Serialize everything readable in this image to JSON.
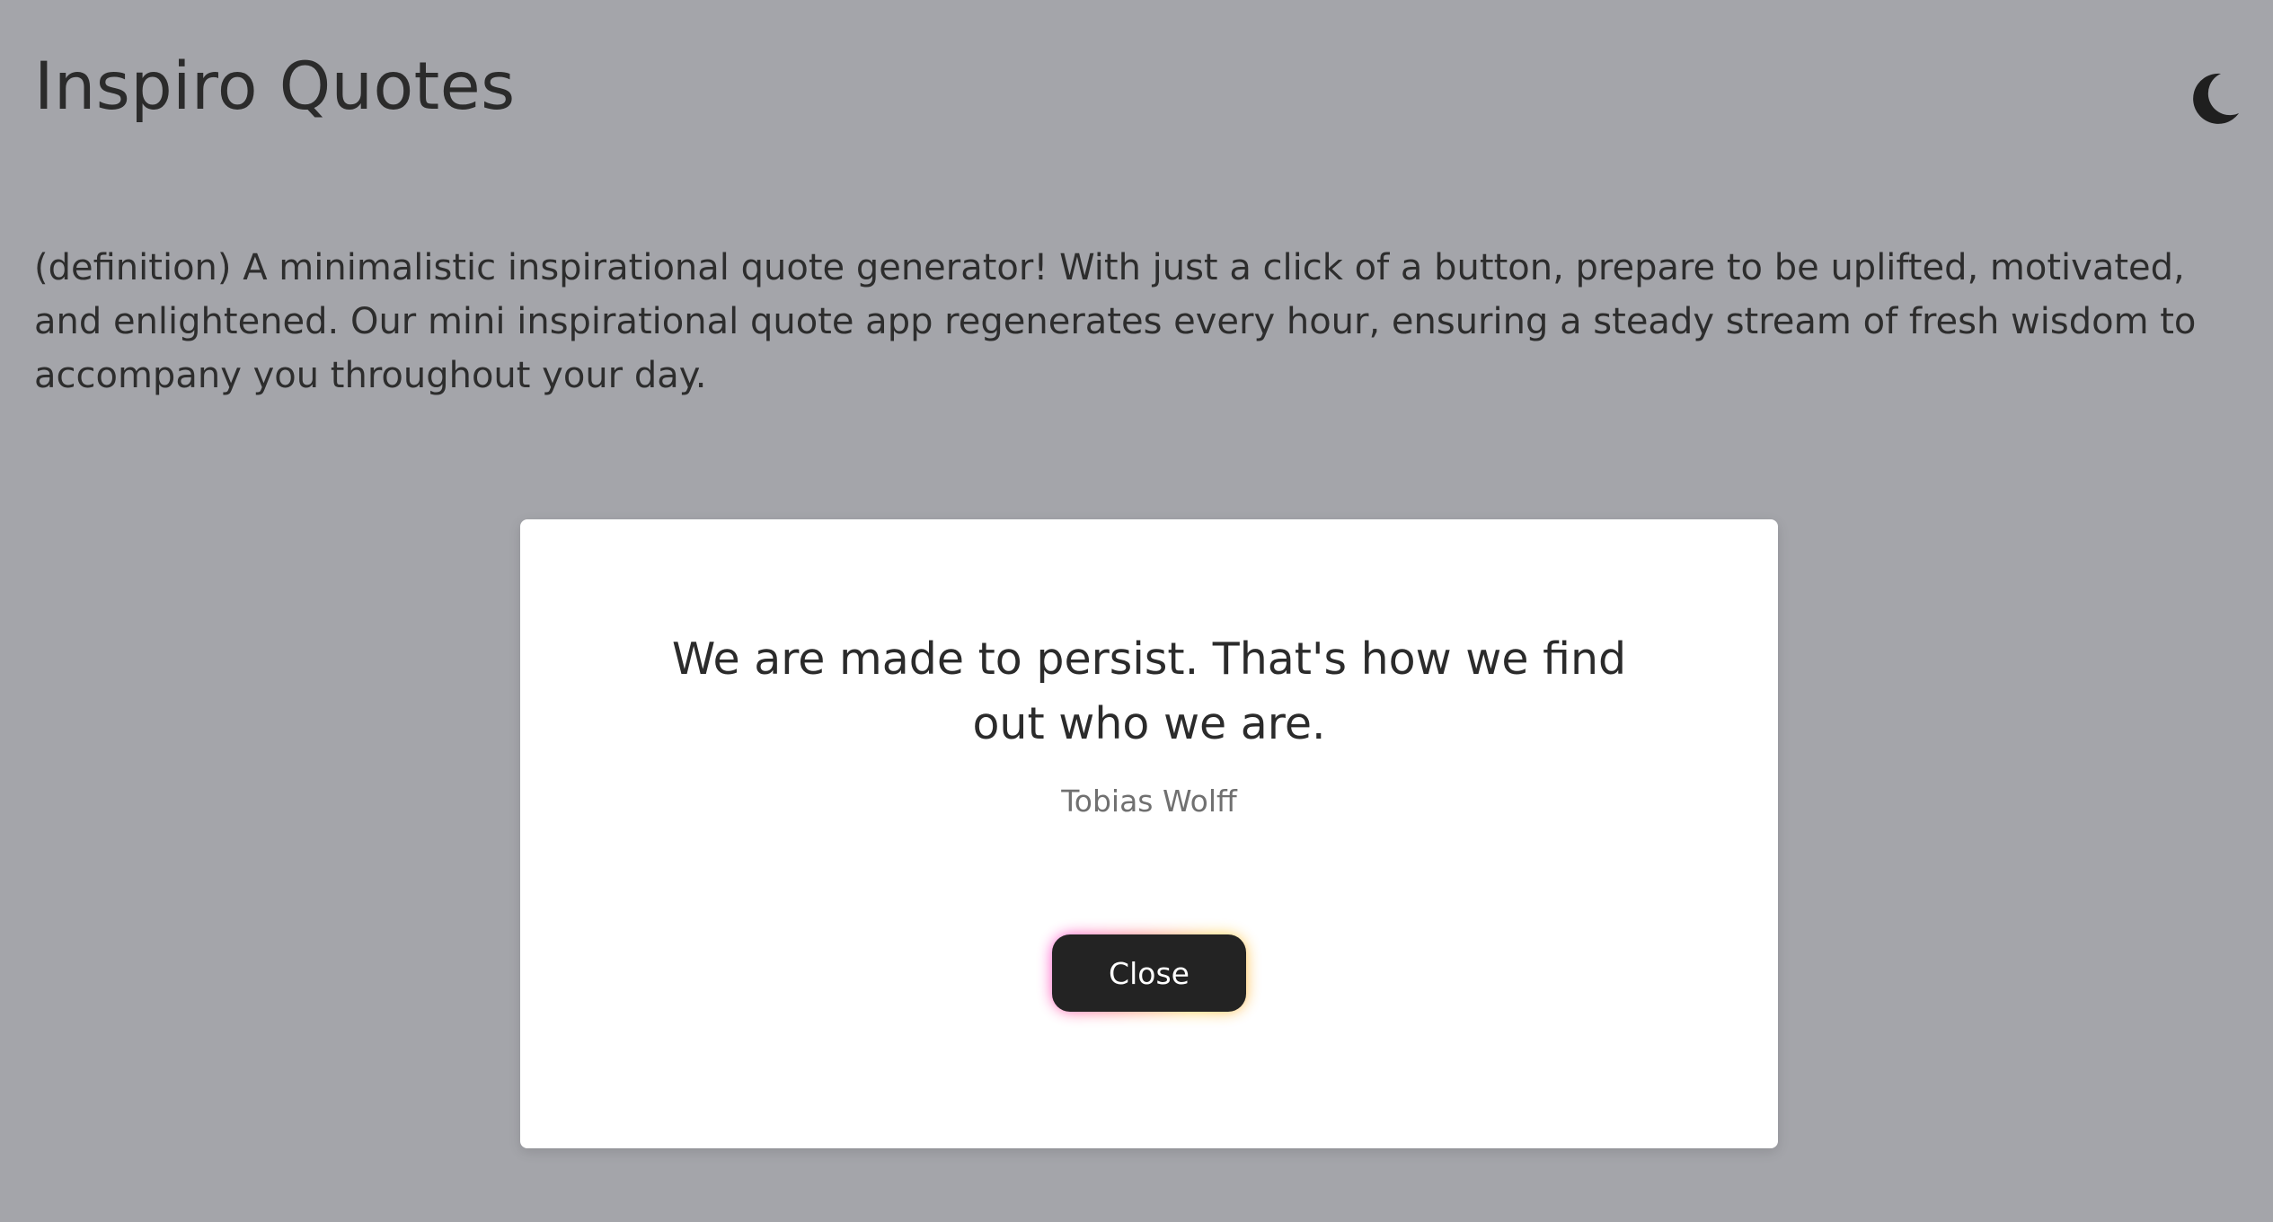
{
  "header": {
    "title": "Inspiro Quotes",
    "theme_toggle_icon": "moon-icon"
  },
  "description": "(definition) A minimalistic inspirational quote generator! With just a click of a button, prepare to be uplifted, motivated, and enlightened. Our mini inspirational quote app regenerates every hour, ensuring a steady stream of fresh wisdom to accompany you throughout your day.",
  "modal": {
    "quote": "We are made to persist. That's how we find out who we are.",
    "author": "Tobias Wolff",
    "close_label": "Close"
  },
  "colors": {
    "background": "#a4a5aa",
    "modal_background": "#ffffff",
    "button_background": "#232323",
    "text": "#2b2b2b"
  }
}
